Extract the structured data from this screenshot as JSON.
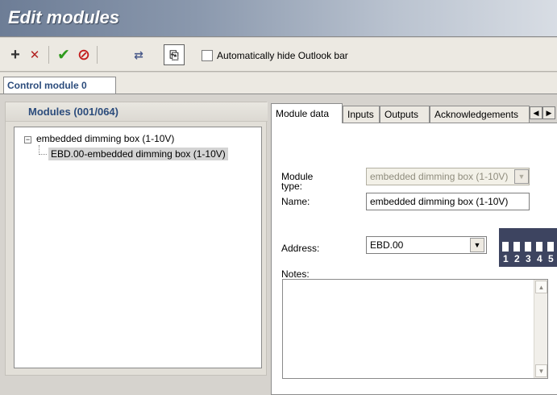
{
  "window": {
    "title": "Edit modules"
  },
  "toolbar": {
    "add_icon": "+",
    "delete_icon": "✕",
    "confirm_icon": "✔",
    "cancel_icon": "⊘",
    "auto_icon": "⇄",
    "outlook_icon": "⎘",
    "auto_hide_label": "Automatically hide Outlook bar",
    "auto_hide_checked": false
  },
  "control_tabs": [
    {
      "label": "Control module 0"
    }
  ],
  "modules_panel": {
    "header": "Modules (001/064)",
    "tree": {
      "root": "embedded dimming box (1-10V)",
      "child": "EBD.00-embedded dimming box (1-10V)"
    }
  },
  "detail_tabs": [
    {
      "label": "Module data"
    },
    {
      "label": "Inputs"
    },
    {
      "label": "Outputs"
    },
    {
      "label": "Acknowledgements"
    }
  ],
  "module_data": {
    "module_type_label": "Module type:",
    "module_type_value": "embedded dimming box (1-10V)",
    "name_label": "Name:",
    "name_value": "embedded dimming box (1-10V)",
    "address_label": "Address:",
    "address_value": "EBD.00",
    "notes_label": "Notes:",
    "notes_value": "",
    "dip_switches": [
      "1",
      "2",
      "3",
      "4",
      "5"
    ]
  },
  "colors": {
    "title_text": "#ffffff",
    "accent_blue": "#2c4c7c",
    "dip_bg": "#3d4460",
    "check_green": "#2e9a1c",
    "cancel_red": "#c41c1c"
  }
}
